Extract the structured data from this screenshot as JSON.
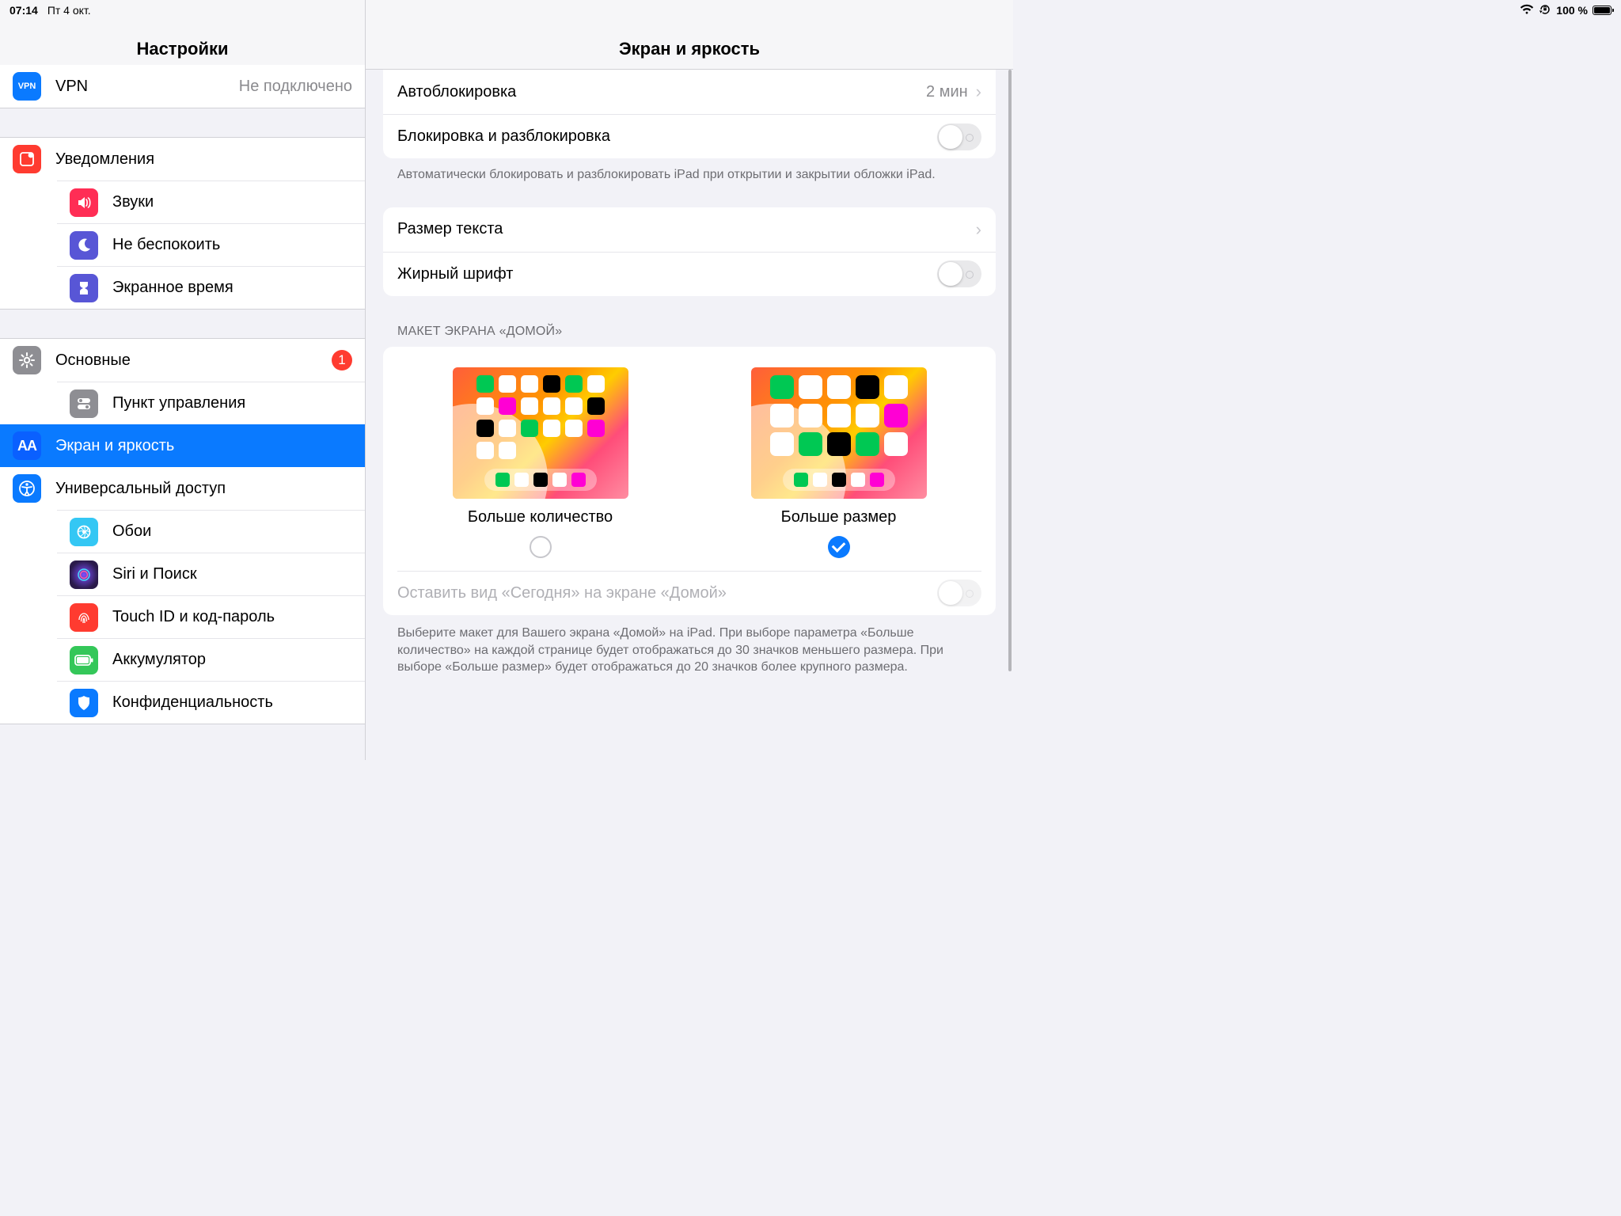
{
  "statusbar": {
    "time": "07:14",
    "date": "Пт 4 окт.",
    "battery_label": "100 %"
  },
  "sidebar": {
    "title": "Настройки",
    "group_vpn": {
      "vpn": {
        "label": "VPN",
        "value": "Не подключено",
        "icon_text": "VPN"
      }
    },
    "group_alerts": {
      "notifications": {
        "label": "Уведомления"
      },
      "sounds": {
        "label": "Звуки"
      },
      "dnd": {
        "label": "Не беспокоить"
      },
      "screentime": {
        "label": "Экранное время"
      }
    },
    "group_general": {
      "general": {
        "label": "Основные",
        "badge": "1"
      },
      "control": {
        "label": "Пункт управления"
      },
      "display": {
        "label": "Экран и яркость"
      },
      "accessibility": {
        "label": "Универсальный доступ"
      },
      "wallpaper": {
        "label": "Обои"
      },
      "siri": {
        "label": "Siri и Поиск"
      },
      "touchid": {
        "label": "Touch ID и код-пароль"
      },
      "battery": {
        "label": "Аккумулятор"
      },
      "privacy": {
        "label": "Конфиденциальность"
      }
    }
  },
  "detail": {
    "title": "Экран и яркость",
    "autolock": {
      "label": "Автоблокировка",
      "value": "2 мин"
    },
    "lockunlock": {
      "label": "Блокировка и разблокировка",
      "footer": "Автоматически блокировать и разблокировать iPad при открытии и закрытии обложки iPad."
    },
    "textsize": {
      "label": "Размер текста"
    },
    "bold": {
      "label": "Жирный шрифт"
    },
    "homelayout": {
      "header": "МАКЕТ ЭКРАНА «ДОМОЙ»",
      "more": "Больше количество",
      "bigger": "Больше размер",
      "today": "Оставить вид «Сегодня» на экране «Домой»",
      "footer": "Выберите макет для Вашего экрана «Домой» на iPad. При выборе параметра «Больше количество» на каждой странице будет отображаться до 30 значков меньшего размера. При выборе «Больше размер» будет отображаться до 20 значков более крупного размера."
    }
  }
}
